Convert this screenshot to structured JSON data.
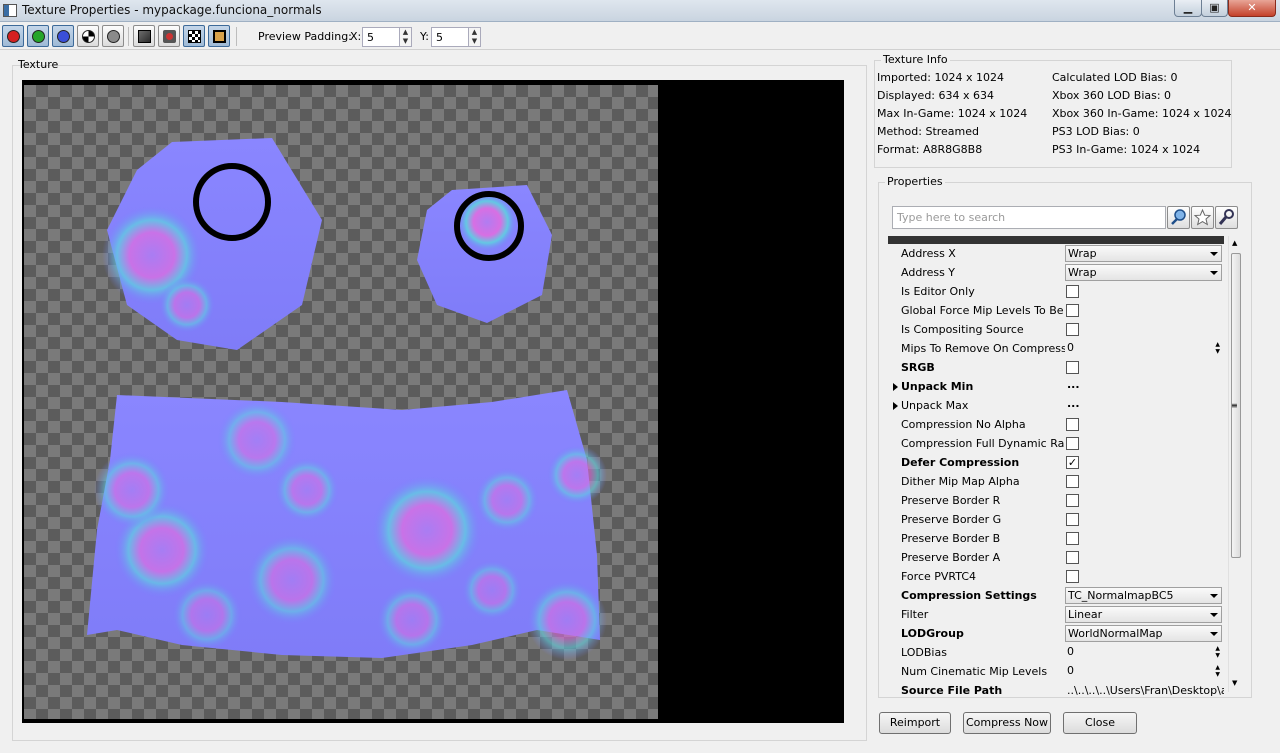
{
  "window": {
    "title": "Texture Properties - mypackage.funciona_normals",
    "min_glyph": "▁",
    "max_glyph": "▣",
    "close_glyph": "✕"
  },
  "toolbar": {
    "preview_padding_label": "Preview Padding:",
    "x_label": "X:",
    "x_value": "5",
    "y_label": "Y:",
    "y_value": "5",
    "channel_colors": {
      "red": "#d42020",
      "green": "#25a52a",
      "blue": "#3a4fd8",
      "alpha": "#ffffff",
      "gray": "#8a8a8a"
    }
  },
  "texture_pane": {
    "label": "Texture"
  },
  "texture_info": {
    "title": "Texture Info",
    "left": [
      "Imported: 1024 x 1024",
      "Displayed: 634 x 634",
      "Max In-Game: 1024 x 1024",
      "Method: Streamed",
      "Format: A8R8G8B8"
    ],
    "right": [
      "Calculated LOD Bias: 0",
      "Xbox 360 LOD Bias: 0",
      "Xbox 360 In-Game: 1024 x 1024",
      "PS3 LOD Bias: 0",
      "PS3 In-Game: 1024 x 1024"
    ]
  },
  "properties": {
    "title": "Properties",
    "search_placeholder": "Type here to search",
    "rows": [
      {
        "name": "Address X",
        "bold": false,
        "kind": "combo",
        "value": "Wrap"
      },
      {
        "name": "Address Y",
        "bold": false,
        "kind": "combo",
        "value": "Wrap"
      },
      {
        "name": "Is Editor Only",
        "bold": false,
        "kind": "check",
        "checked": false
      },
      {
        "name": "Global Force Mip Levels To Be Res",
        "bold": false,
        "kind": "check",
        "checked": false
      },
      {
        "name": "Is Compositing Source",
        "bold": false,
        "kind": "check",
        "checked": false
      },
      {
        "name": "Mips To Remove On Compress",
        "bold": false,
        "kind": "number",
        "value": "0"
      },
      {
        "name": "SRGB",
        "bold": true,
        "kind": "check",
        "checked": false
      },
      {
        "name": "Unpack Min",
        "bold": true,
        "kind": "dots",
        "value": "...",
        "expandable": true
      },
      {
        "name": "Unpack Max",
        "bold": false,
        "kind": "dots",
        "value": "...",
        "expandable": true
      },
      {
        "name": "Compression No Alpha",
        "bold": false,
        "kind": "check",
        "checked": false
      },
      {
        "name": "Compression Full Dynamic Range",
        "bold": false,
        "kind": "check",
        "checked": false
      },
      {
        "name": "Defer Compression",
        "bold": true,
        "kind": "check",
        "checked": true
      },
      {
        "name": "Dither Mip Map Alpha",
        "bold": false,
        "kind": "check",
        "checked": false
      },
      {
        "name": "Preserve Border R",
        "bold": false,
        "kind": "check",
        "checked": false
      },
      {
        "name": "Preserve Border G",
        "bold": false,
        "kind": "check",
        "checked": false
      },
      {
        "name": "Preserve Border B",
        "bold": false,
        "kind": "check",
        "checked": false
      },
      {
        "name": "Preserve Border A",
        "bold": false,
        "kind": "check",
        "checked": false
      },
      {
        "name": "Force PVRTC4",
        "bold": false,
        "kind": "check",
        "checked": false
      },
      {
        "name": "Compression Settings",
        "bold": true,
        "kind": "combo",
        "value": "TC_NormalmapBC5"
      },
      {
        "name": "Filter",
        "bold": false,
        "kind": "combo",
        "value": "Linear"
      },
      {
        "name": "LODGroup",
        "bold": true,
        "kind": "combo",
        "value": "WorldNormalMap"
      },
      {
        "name": "LODBias",
        "bold": false,
        "kind": "number",
        "value": "0"
      },
      {
        "name": "Num Cinematic Mip Levels",
        "bold": false,
        "kind": "number",
        "value": "0"
      },
      {
        "name": "Source File Path",
        "bold": true,
        "kind": "text",
        "value": "..\\..\\..\\..\\Users\\Fran\\Desktop\\as"
      }
    ]
  },
  "buttons": {
    "reimport": "Reimport",
    "compress_now": "Compress Now",
    "close": "Close"
  }
}
